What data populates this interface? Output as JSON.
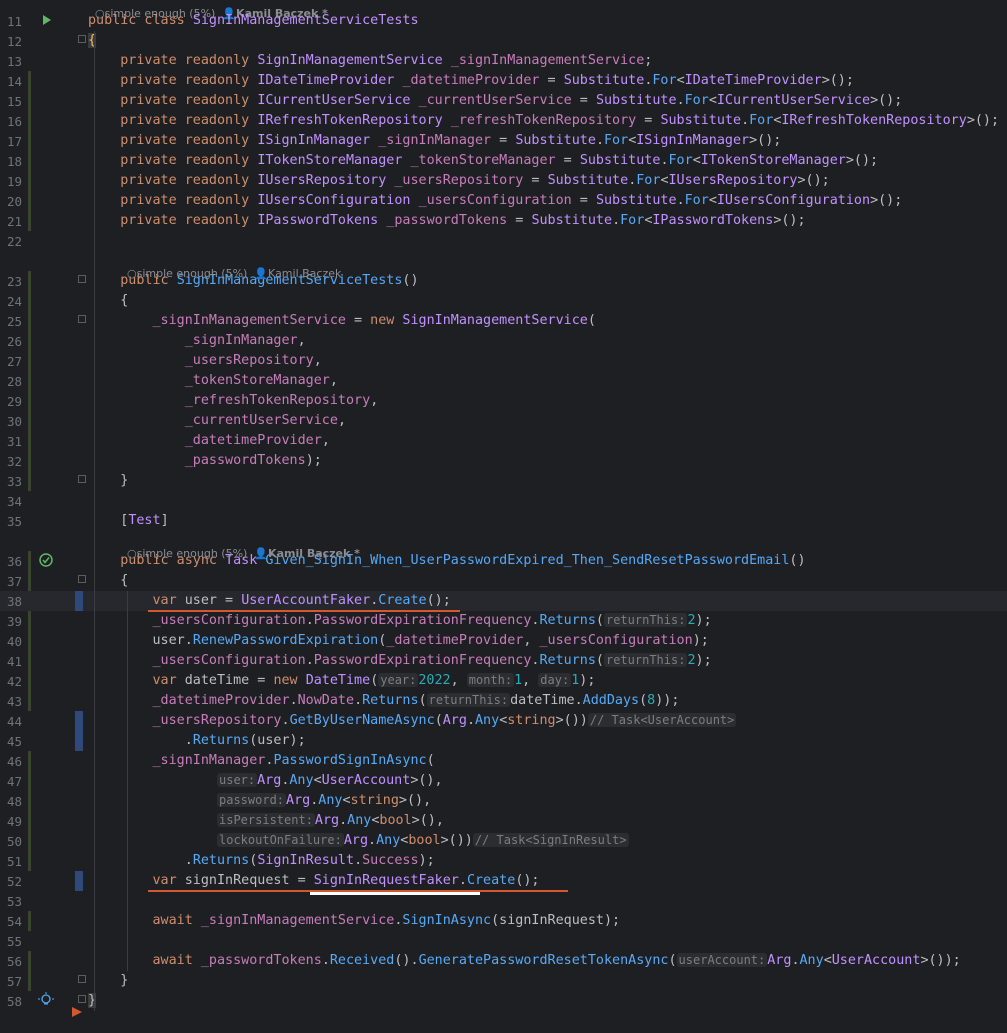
{
  "hints": {
    "top": "simple enough (5%)",
    "top_author": "Kamil Bączek *",
    "ctor": "simple enough (5%)",
    "ctor_author": "Kamil Bączek",
    "test": "simple enough (5%)",
    "test_author": "Kamil Bączek *"
  },
  "lines": [
    {
      "n": "11",
      "html": "<span class='kw'>public class</span> <span class='ty'>SignInManagementServiceTests</span>"
    },
    {
      "n": "12",
      "html": "<span style='color:#e8bf6a;background:#3b3b3b'>{</span>"
    },
    {
      "n": "13",
      "html": "    <span class='kw'>private readonly</span> <span class='ty'>SignInManagementService</span> <span class='fld'>_signInManagementService</span>;"
    },
    {
      "n": "14",
      "html": "    <span class='kw'>private readonly</span> <span class='ty'>IDateTimeProvider</span> <span class='fld'>_datetimeProvider</span> = <span class='ty'>Substitute</span>.<span class='mt'>For</span>&lt;<span class='ty'>IDateTimeProvider</span>&gt;();"
    },
    {
      "n": "15",
      "html": "    <span class='kw'>private readonly</span> <span class='ty'>ICurrentUserService</span> <span class='fld'>_currentUserService</span> = <span class='ty'>Substitute</span>.<span class='mt'>For</span>&lt;<span class='ty'>ICurrentUserService</span>&gt;();"
    },
    {
      "n": "16",
      "html": "    <span class='kw'>private readonly</span> <span class='ty'>IRefreshTokenRepository</span> <span class='fld'>_refreshTokenRepository</span> = <span class='ty'>Substitute</span>.<span class='mt'>For</span>&lt;<span class='ty'>IRefreshTokenRepository</span>&gt;();"
    },
    {
      "n": "17",
      "html": "    <span class='kw'>private readonly</span> <span class='ty'>ISignInManager</span> <span class='fld'>_signInManager</span> = <span class='ty'>Substitute</span>.<span class='mt'>For</span>&lt;<span class='ty'>ISignInManager</span>&gt;();"
    },
    {
      "n": "18",
      "html": "    <span class='kw'>private readonly</span> <span class='ty'>ITokenStoreManager</span> <span class='fld'>_tokenStoreManager</span> = <span class='ty'>Substitute</span>.<span class='mt'>For</span>&lt;<span class='ty'>ITokenStoreManager</span>&gt;();"
    },
    {
      "n": "19",
      "html": "    <span class='kw'>private readonly</span> <span class='ty'>IUsersRepository</span> <span class='fld'>_usersRepository</span> = <span class='ty'>Substitute</span>.<span class='mt'>For</span>&lt;<span class='ty'>IUsersRepository</span>&gt;();"
    },
    {
      "n": "20",
      "html": "    <span class='kw'>private readonly</span> <span class='ty'>IUsersConfiguration</span> <span class='fld'>_usersConfiguration</span> = <span class='ty'>Substitute</span>.<span class='mt'>For</span>&lt;<span class='ty'>IUsersConfiguration</span>&gt;();"
    },
    {
      "n": "21",
      "html": "    <span class='kw'>private readonly</span> <span class='ty'>IPasswordTokens</span> <span class='fld'>_passwordTokens</span> = <span class='ty'>Substitute</span>.<span class='mt'>For</span>&lt;<span class='ty'>IPasswordTokens</span>&gt;();"
    },
    {
      "n": "22",
      "html": ""
    },
    {
      "n": "23",
      "html": "    <span class='kw'>public</span> <span class='fn'>SignInManagementServiceTests</span>()"
    },
    {
      "n": "24",
      "html": "    {"
    },
    {
      "n": "25",
      "html": "        <span class='fld'>_signInManagementService</span> = <span class='kw'>new</span> <span class='ty'>SignInManagementService</span>("
    },
    {
      "n": "26",
      "html": "            <span class='fld'>_signInManager</span>,"
    },
    {
      "n": "27",
      "html": "            <span class='fld'>_usersRepository</span>,"
    },
    {
      "n": "28",
      "html": "            <span class='fld'>_tokenStoreManager</span>,"
    },
    {
      "n": "29",
      "html": "            <span class='fld'>_refreshTokenRepository</span>,"
    },
    {
      "n": "30",
      "html": "            <span class='fld'>_currentUserService</span>,"
    },
    {
      "n": "31",
      "html": "            <span class='fld'>_datetimeProvider</span>,"
    },
    {
      "n": "32",
      "html": "            <span class='fld'>_passwordTokens</span>);"
    },
    {
      "n": "33",
      "html": "    }"
    },
    {
      "n": "34",
      "html": ""
    },
    {
      "n": "35",
      "html": "    [<span class='ty'>Test</span>]"
    },
    {
      "n": "36",
      "html": "    <span class='kw'>public async</span> <span class='ty'>Task</span> <span class='fn'>Given_SignIn_When_UserPasswordExpired_Then_SendResetPasswordEmail</span>()"
    },
    {
      "n": "37",
      "html": "    {"
    },
    {
      "n": "38",
      "html": "        <span class='kw'>var</span> user = <span class='ty'>UserAccountFaker</span>.<span class='mt'>Create</span>();"
    },
    {
      "n": "39",
      "html": "        <span class='fld'>_usersConfiguration</span>.<span class='fld'>PasswordExpirationFrequency</span>.<span class='mt'>Returns</span>(<span class='inl'>returnThis:</span><span class='num'>2</span>);"
    },
    {
      "n": "40",
      "html": "        user.<span class='mt'>RenewPasswordExpiration</span>(<span class='fld'>_datetimeProvider</span>, <span class='fld'>_usersConfiguration</span>);"
    },
    {
      "n": "41",
      "html": "        <span class='fld'>_usersConfiguration</span>.<span class='fld'>PasswordExpirationFrequency</span>.<span class='mt'>Returns</span>(<span class='inl'>returnThis:</span><span class='num'>2</span>);"
    },
    {
      "n": "42",
      "html": "        <span class='kw'>var</span> dateTime = <span class='kw'>new</span> <span class='ty'>DateTime</span>(<span class='inl'>year:</span><span class='num'>2022</span>, <span class='inl'>month:</span><span class='num'>1</span>, <span class='inl'>day:</span><span class='num'>1</span>);"
    },
    {
      "n": "43",
      "html": "        <span class='fld'>_datetimeProvider</span>.<span class='fld'>NowDate</span>.<span class='mt'>Returns</span>(<span class='inl'>returnThis:</span>dateTime.<span class='mt'>AddDays</span>(<span class='num'>8</span>));"
    },
    {
      "n": "44",
      "html": "        <span class='fld'>_usersRepository</span>.<span class='mt'>GetByUserNameAsync</span>(<span class='ty'>Arg</span>.<span class='mt'>Any</span>&lt;<span class='kw'>string</span>&gt;())<span class='inl'>// Task&lt;UserAccount&gt;</span>"
    },
    {
      "n": "45",
      "html": "            .<span class='mt'>Returns</span>(user);"
    },
    {
      "n": "46",
      "html": "        <span class='fld'>_signInManager</span>.<span class='mt'>PasswordSignInAsync</span>("
    },
    {
      "n": "47",
      "html": "                <span class='inl'>user:</span><span class='ty'>Arg</span>.<span class='mt'>Any</span>&lt;<span class='ty'>UserAccount</span>&gt;(),"
    },
    {
      "n": "48",
      "html": "                <span class='inl'>password:</span><span class='ty'>Arg</span>.<span class='mt'>Any</span>&lt;<span class='kw'>string</span>&gt;(),"
    },
    {
      "n": "49",
      "html": "                <span class='inl'>isPersistent:</span><span class='ty'>Arg</span>.<span class='mt'>Any</span>&lt;<span class='kw'>bool</span>&gt;(),"
    },
    {
      "n": "50",
      "html": "                <span class='inl'>lockoutOnFailure:</span><span class='ty'>Arg</span>.<span class='mt'>Any</span>&lt;<span class='kw'>bool</span>&gt;())<span class='inl'>// Task&lt;SignInResult&gt;</span>"
    },
    {
      "n": "51",
      "html": "            .<span class='mt'>Returns</span>(<span class='ty'>SignInResult</span>.<span class='fld'>Success</span>);"
    },
    {
      "n": "52",
      "html": "        <span class='kw'>var</span> signInRequest = <span class='ty'>SignInRequestFaker</span>.<span class='mt'>Create</span>();"
    },
    {
      "n": "53",
      "html": ""
    },
    {
      "n": "54",
      "html": "        <span class='kw'>await</span> <span class='fld'>_signInManagementService</span>.<span class='mt'>SignInAsync</span>(signInRequest);"
    },
    {
      "n": "55",
      "html": ""
    },
    {
      "n": "56",
      "html": "        <span class='kw'>await</span> <span class='fld'>_passwordTokens</span>.<span class='mt'>Received</span>().<span class='mt'>GeneratePasswordResetTokenAsync</span>(<span class='inl'>userAccount:</span><span class='ty'>Arg</span>.<span class='mt'>Any</span>&lt;<span class='ty'>UserAccount</span>&gt;());"
    },
    {
      "n": "57",
      "html": "    }"
    },
    {
      "n": "58",
      "html": "<span style='background:#3b3b3b'>}</span>"
    }
  ]
}
